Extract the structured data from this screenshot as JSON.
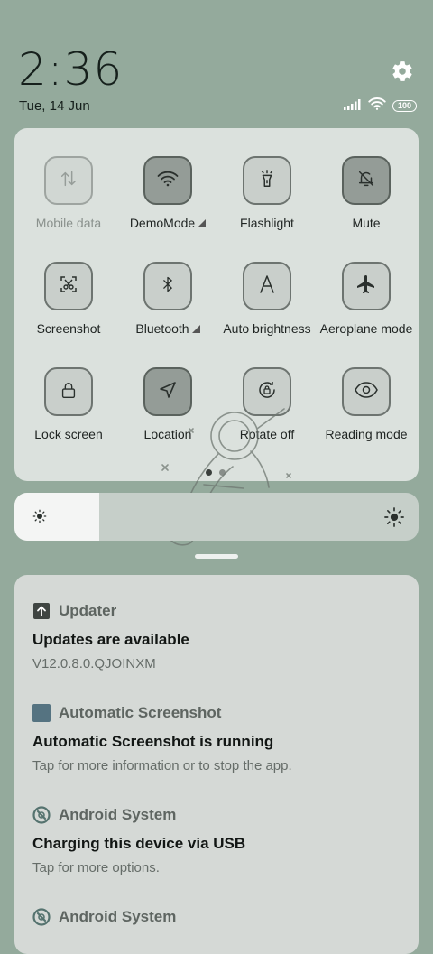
{
  "status": {
    "time": "2:36",
    "date": "Tue, 14 Jun",
    "battery": "100"
  },
  "quick_settings": {
    "tiles": [
      {
        "label": "Mobile data",
        "icon": "mobile-data-icon",
        "state": "disabled"
      },
      {
        "label": "DemoMode",
        "icon": "wifi-icon",
        "state": "active",
        "expand": true
      },
      {
        "label": "Flashlight",
        "icon": "flashlight-icon",
        "state": "inactive"
      },
      {
        "label": "Mute",
        "icon": "bell-off-icon",
        "state": "active"
      },
      {
        "label": "Screenshot",
        "icon": "screenshot-icon",
        "state": "inactive"
      },
      {
        "label": "Bluetooth",
        "icon": "bluetooth-icon",
        "state": "inactive",
        "expand": true
      },
      {
        "label": "Auto brightness",
        "icon": "auto-brightness-icon",
        "state": "inactive"
      },
      {
        "label": "Aeroplane mode",
        "icon": "airplane-icon",
        "state": "inactive"
      },
      {
        "label": "Lock screen",
        "icon": "lock-icon",
        "state": "inactive"
      },
      {
        "label": "Location",
        "icon": "location-icon",
        "state": "active"
      },
      {
        "label": "Rotate off",
        "icon": "rotate-lock-icon",
        "state": "inactive"
      },
      {
        "label": "Reading mode",
        "icon": "eye-icon",
        "state": "inactive"
      }
    ],
    "page": 1,
    "page_count": 2
  },
  "brightness": {
    "level": 0.21
  },
  "notifications": [
    {
      "app": "Updater",
      "icon": "upload-arrow-icon",
      "title": "Updates are available",
      "text": "V12.0.8.0.QJOINXM"
    },
    {
      "app": "Automatic Screenshot",
      "icon": "app-square-icon",
      "title": "Automatic Screenshot is running",
      "text": "Tap for more information or to stop the app."
    },
    {
      "app": "Android System",
      "icon": "android-system-icon",
      "title": "Charging this device via USB",
      "text": "Tap for more options."
    },
    {
      "app": "Android System",
      "icon": "android-system-icon",
      "title": "",
      "text": ""
    }
  ],
  "colors": {
    "background": "#94aa9c",
    "tile_active": "#949c97",
    "tile_inactive": "#c9cfcb"
  }
}
